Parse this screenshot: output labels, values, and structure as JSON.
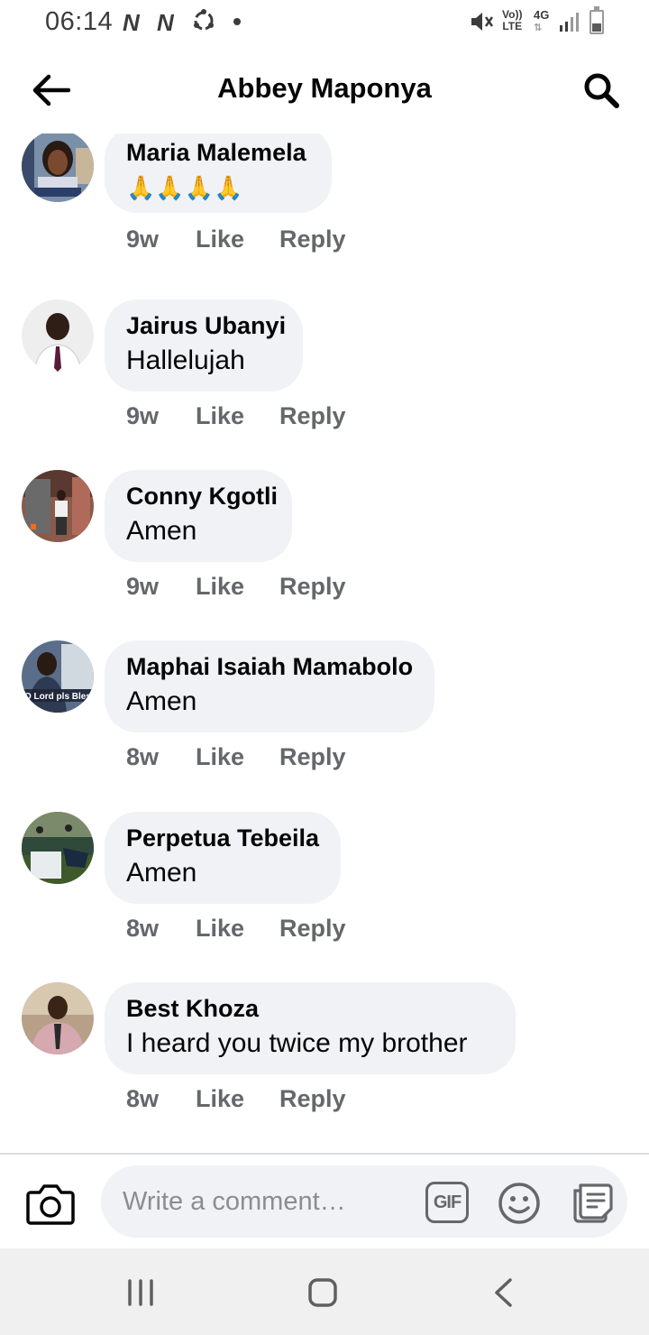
{
  "status_bar": {
    "time": "06:14",
    "network_badges": [
      "N",
      "N"
    ],
    "volte_top": "Vo))",
    "volte_bottom": "LTE",
    "network_type": "4G"
  },
  "header": {
    "title": "Abbey Maponya",
    "back_icon": "arrow-left-icon",
    "search_icon": "search-icon"
  },
  "comments": [
    {
      "author": "Maria Malemela",
      "text": "🙏🙏🙏🙏",
      "time": "9w",
      "like_label": "Like",
      "reply_label": "Reply"
    },
    {
      "author": "Jairus Ubanyi",
      "text": "Hallelujah",
      "time": "9w",
      "like_label": "Like",
      "reply_label": "Reply"
    },
    {
      "author": "Conny Kgotli",
      "text": "Amen",
      "time": "9w",
      "like_label": "Like",
      "reply_label": "Reply"
    },
    {
      "author": "Maphai Isaiah Mamabolo",
      "text": "Amen",
      "time": "8w",
      "like_label": "Like",
      "reply_label": "Reply",
      "avatar_caption": "O Lord pls Bless"
    },
    {
      "author": "Perpetua Tebeila",
      "text": "Amen",
      "time": "8w",
      "like_label": "Like",
      "reply_label": "Reply"
    },
    {
      "author": "Best Khoza",
      "text": "I heard you twice my brother",
      "time": "8w",
      "like_label": "Like",
      "reply_label": "Reply"
    }
  ],
  "composer": {
    "placeholder": "Write a comment…",
    "gif_label": "GIF",
    "camera_icon": "camera-icon",
    "emoji_icon": "smiley-icon",
    "sticker_icon": "sticker-icon"
  },
  "nav_bar": {
    "recents_icon": "recents-icon",
    "home_icon": "home-icon",
    "back_icon": "chevron-left-icon"
  },
  "colors": {
    "bubble": "#f0f2f5",
    "secondary_text": "#65676b",
    "primary_text": "#050505"
  }
}
